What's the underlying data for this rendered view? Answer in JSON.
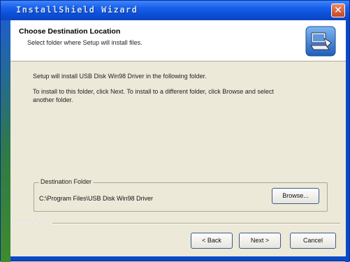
{
  "window": {
    "title": "InstallShield Wizard",
    "close_glyph": "✕"
  },
  "header": {
    "title": "Choose Destination Location",
    "subtitle": "Select folder where Setup will install files.",
    "icon": "setup-computer-icon"
  },
  "body": {
    "line1": "Setup will install USB Disk Win98 Driver in the following folder.",
    "line2": "To install to this folder, click Next. To install to a different folder, click Browse and select",
    "line3": "another folder."
  },
  "destination": {
    "group_label": "Destination Folder",
    "path": "C:\\Program Files\\USB Disk Win98 Driver",
    "browse_label": "Browse..."
  },
  "footer": {
    "brand": "InstallShield",
    "back_label": "< Back",
    "next_label": "Next >",
    "cancel_label": "Cancel"
  },
  "colors": {
    "titlebar": "#0b4fd8",
    "dialog_bg": "#ece9d8",
    "header_bg": "#ffffff",
    "close": "#c4461f"
  }
}
